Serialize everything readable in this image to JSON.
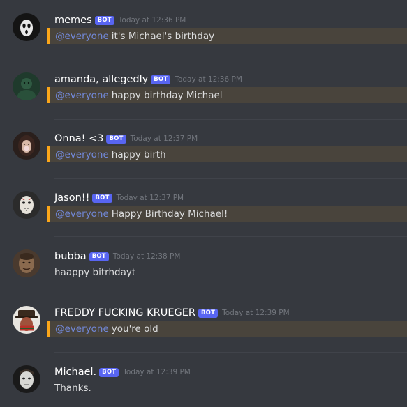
{
  "colors": {
    "background": "#36393f",
    "bot_tag": "#5865f2",
    "mention_bar": "#faa61a",
    "mention_bg": "#49443c",
    "mention_text": "#7289da",
    "timestamp": "#72767d"
  },
  "bot_label": "BOT",
  "messages": [
    {
      "username": "memes",
      "timestamp": "Today at 12:36 PM",
      "mention": "@everyone",
      "text": "it's Michael's birthday",
      "avatar_icon": "ghostface-mask-avatar"
    },
    {
      "username": "amanda, allegedly",
      "timestamp": "Today at 12:36 PM",
      "mention": "@everyone",
      "text": "happy birthday Michael",
      "avatar_icon": "dark-green-figure-avatar"
    },
    {
      "username": "Onna! <3",
      "timestamp": "Today at 12:37 PM",
      "mention": "@everyone",
      "text": "happy birth",
      "avatar_icon": "woman-portrait-avatar"
    },
    {
      "username": "Jason!!",
      "timestamp": "Today at 12:37 PM",
      "mention": "@everyone",
      "text": "Happy Birthday Michael!",
      "avatar_icon": "hockey-mask-avatar"
    },
    {
      "username": "bubba",
      "timestamp": "Today at 12:38 PM",
      "mention": "",
      "text": "haappy bitrhdayt",
      "avatar_icon": "leatherface-avatar"
    },
    {
      "username": "FREDDY FUCKING KRUEGER",
      "timestamp": "Today at 12:39 PM",
      "mention": "@everyone",
      "text": "you're old",
      "avatar_icon": "freddy-hat-avatar"
    },
    {
      "username": "Michael.",
      "timestamp": "Today at 12:39 PM",
      "mention": "",
      "text": "Thanks.",
      "avatar_icon": "white-mask-avatar"
    }
  ]
}
